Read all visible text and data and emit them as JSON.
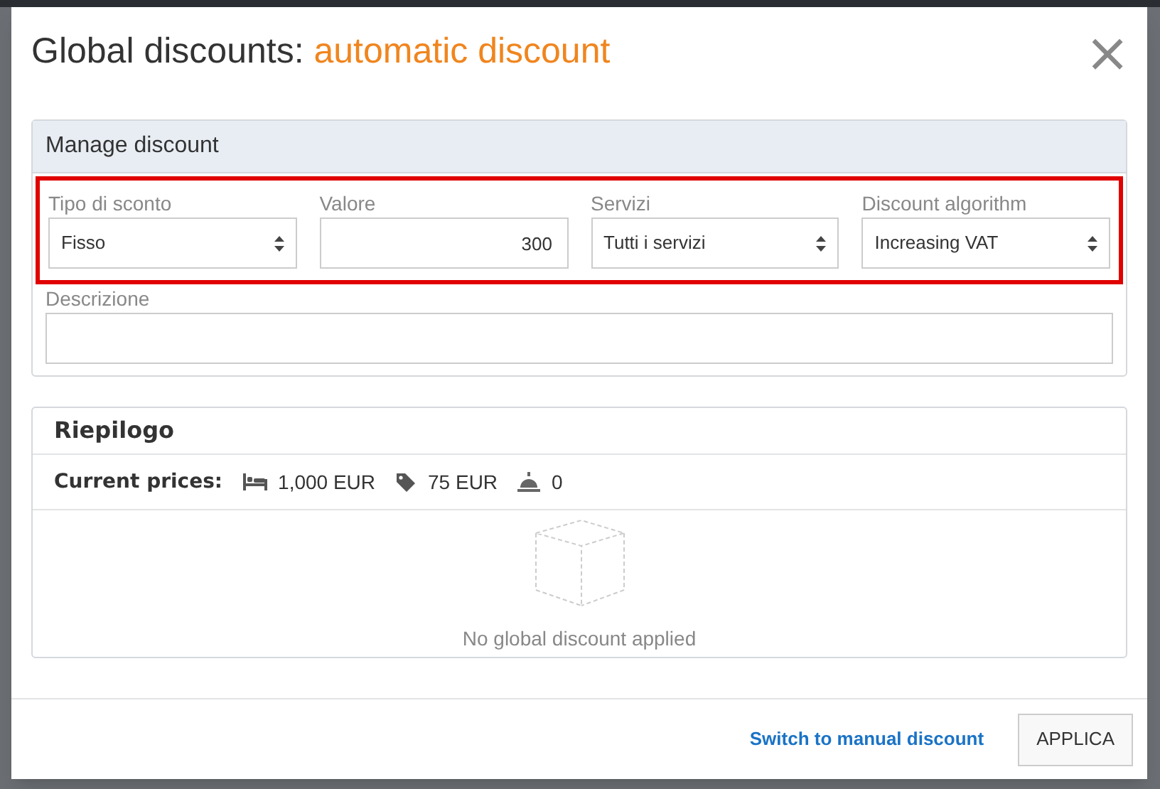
{
  "dialog": {
    "title": "Global discounts:",
    "title_mode": "automatic discount",
    "close": "×"
  },
  "manage": {
    "title": "Manage discount",
    "highlighted": true,
    "fields": [
      {
        "kind": "select",
        "label": "Tipo di sconto",
        "value": "Fisso"
      },
      {
        "kind": "number",
        "label": "Valore",
        "value": "300"
      },
      {
        "kind": "select",
        "label": "Servizi",
        "value": "Tutti i servizi"
      },
      {
        "kind": "select",
        "label": "Discount algorithm",
        "value": "Increasing VAT"
      }
    ],
    "description": {
      "label": "Descrizione"
    }
  },
  "summary": {
    "title": "Riepilogo",
    "prices_label": "Current prices:",
    "prices": [
      {
        "kind": "room",
        "value": "1,000 EUR"
      },
      {
        "kind": "tag",
        "value": "75 EUR"
      },
      {
        "kind": "service",
        "value": "0"
      }
    ],
    "empty_text": "No global discount applied"
  },
  "footer": {
    "link": "Switch to manual discount",
    "button": "APPLICA"
  }
}
